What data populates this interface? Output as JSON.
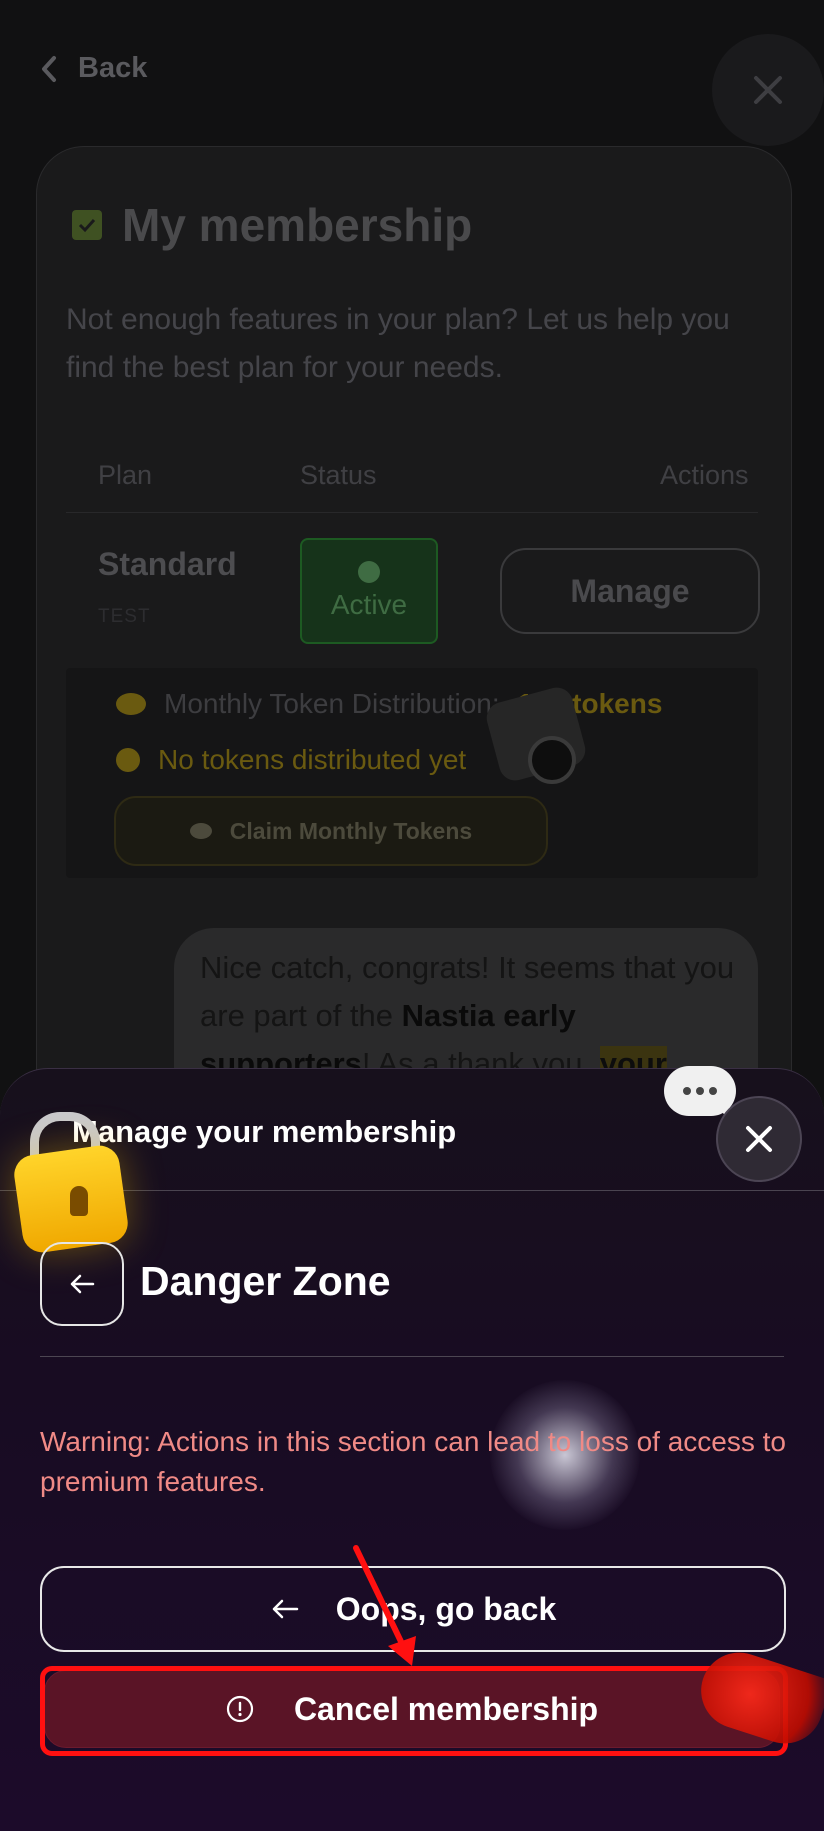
{
  "background_page": {
    "back_label": "Back",
    "title": "My membership",
    "description": "Not enough features in your plan? Let us help you find the best plan for your needs.",
    "table_headers": [
      "Plan",
      "Status",
      "Actions"
    ],
    "plan": {
      "name": "Standard",
      "sub_label": "TEST",
      "status": "Active",
      "action": "Manage"
    },
    "tokens": {
      "distribution_label": "Monthly Token Distribution:",
      "distribution_value": "100 tokens",
      "notice": "No tokens distributed yet",
      "claim_label": "Claim Monthly Tokens"
    },
    "chat_message": {
      "part1": "Nice catch, congrats! It seems that you are part of the ",
      "bold": "Nastia early supporters",
      "part2": "! As a thank you, ",
      "highlight": "your"
    }
  },
  "sheet": {
    "title": "Manage your membership",
    "section_title": "Danger Zone",
    "warning": "Warning: Actions in this section can lead to loss of access to premium features.",
    "go_back_label": "Oops, go back",
    "cancel_label": "Cancel membership"
  },
  "colors": {
    "danger_text": "#f08a86",
    "cancel_bg": "#5a1426",
    "highlight_red": "#ff1010",
    "token_gold": "#6a5a10",
    "active_green": "#1d5a22"
  },
  "icons": [
    "chevron-left-icon",
    "close-icon",
    "checkbox-icon",
    "check-circle-icon",
    "coin-icon",
    "alert-icon",
    "camera-icon",
    "chat-bubble-icon",
    "padlock-icon",
    "arrow-left-icon",
    "alert-circle-icon",
    "annotation-arrow-icon"
  ]
}
